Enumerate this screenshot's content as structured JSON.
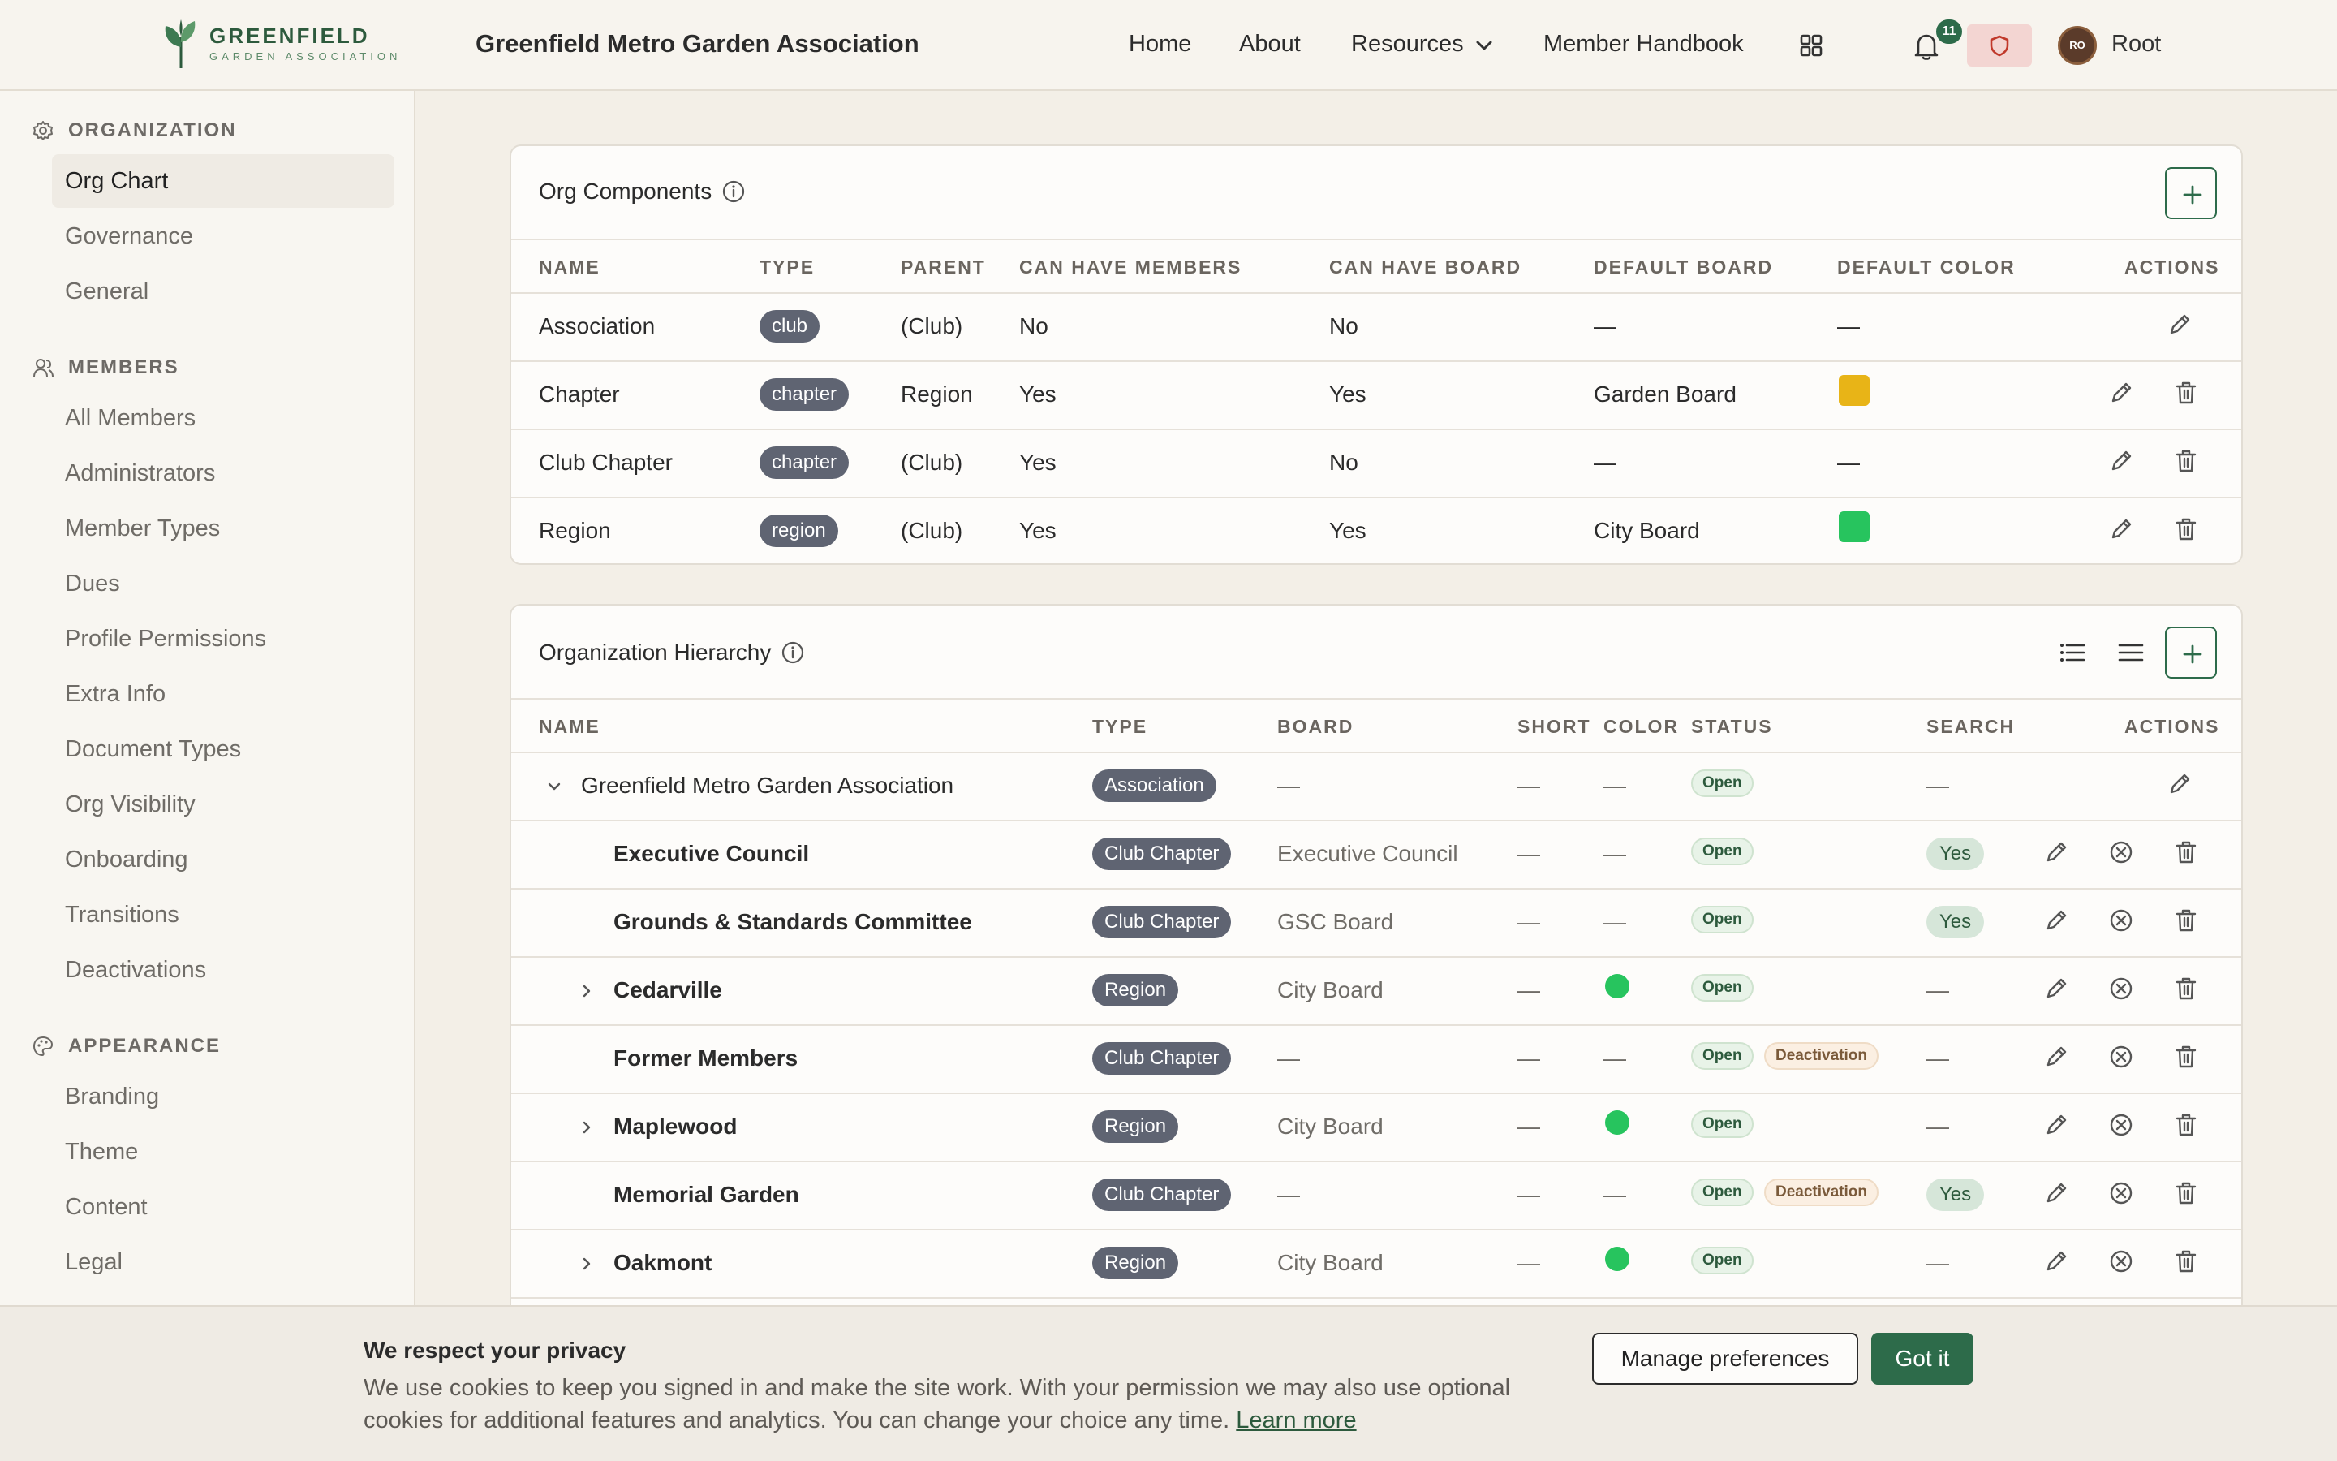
{
  "header": {
    "logo_name": "GREENFIELD",
    "logo_sub": "GARDEN ASSOCIATION",
    "site_title": "Greenfield Metro Garden Association",
    "nav": [
      "Home",
      "About",
      "Resources",
      "Member Handbook"
    ],
    "notification_count": "11",
    "avatar_initials": "RO",
    "user_name": "Root"
  },
  "sidebar": {
    "sections": [
      {
        "title": "ORGANIZATION",
        "icon": "gear-icon",
        "items": [
          "Org Chart",
          "Governance",
          "General"
        ]
      },
      {
        "title": "MEMBERS",
        "icon": "users-icon",
        "items": [
          "All Members",
          "Administrators",
          "Member Types",
          "Dues",
          "Profile Permissions",
          "Extra Info",
          "Document Types",
          "Org Visibility",
          "Onboarding",
          "Transitions",
          "Deactivations"
        ]
      },
      {
        "title": "APPEARANCE",
        "icon": "palette-icon",
        "items": [
          "Branding",
          "Theme",
          "Content",
          "Legal"
        ]
      }
    ],
    "active_item": "Org Chart"
  },
  "org_components": {
    "title": "Org Components",
    "columns": [
      "NAME",
      "TYPE",
      "PARENT",
      "CAN HAVE MEMBERS",
      "CAN HAVE BOARD",
      "DEFAULT BOARD",
      "DEFAULT COLOR",
      "ACTIONS"
    ],
    "rows": [
      {
        "name": "Association",
        "type": "club",
        "parent": "(Club)",
        "members": "No",
        "board": "No",
        "default_board": "—",
        "color": null,
        "deletable": false
      },
      {
        "name": "Chapter",
        "type": "chapter",
        "parent": "Region",
        "members": "Yes",
        "board": "Yes",
        "default_board": "Garden Board",
        "color": "#e8b417",
        "deletable": true
      },
      {
        "name": "Club Chapter",
        "type": "chapter",
        "parent": "(Club)",
        "members": "Yes",
        "board": "No",
        "default_board": "—",
        "color": null,
        "deletable": true
      },
      {
        "name": "Region",
        "type": "region",
        "parent": "(Club)",
        "members": "Yes",
        "board": "Yes",
        "default_board": "City Board",
        "color": "#27c45e",
        "deletable": true
      }
    ]
  },
  "hierarchy": {
    "title": "Organization Hierarchy",
    "columns": [
      "NAME",
      "TYPE",
      "BOARD",
      "SHORT",
      "COLOR",
      "STATUS",
      "SEARCH",
      "ACTIONS"
    ],
    "rows": [
      {
        "name": "Greenfield Metro Garden Association",
        "level": 0,
        "expander": "expanded",
        "type": "Association",
        "board": "—",
        "short": "—",
        "color": null,
        "status": [
          "Open"
        ],
        "search": "—",
        "root": true
      },
      {
        "name": "Executive Council",
        "level": 1,
        "expander": "none",
        "type": "Club Chapter",
        "board": "Executive Council",
        "short": "—",
        "color": null,
        "status": [
          "Open"
        ],
        "search": "Yes"
      },
      {
        "name": "Grounds & Standards Committee",
        "level": 1,
        "expander": "none",
        "type": "Club Chapter",
        "board": "GSC Board",
        "short": "—",
        "color": null,
        "status": [
          "Open"
        ],
        "search": "Yes"
      },
      {
        "name": "Cedarville",
        "level": 1,
        "expander": "collapsed",
        "type": "Region",
        "board": "City Board",
        "short": "—",
        "color": "#27c45e",
        "status": [
          "Open"
        ],
        "search": "—"
      },
      {
        "name": "Former Members",
        "level": 1,
        "expander": "none",
        "type": "Club Chapter",
        "board": "—",
        "short": "—",
        "color": null,
        "status": [
          "Open",
          "Deactivation"
        ],
        "search": "—"
      },
      {
        "name": "Maplewood",
        "level": 1,
        "expander": "collapsed",
        "type": "Region",
        "board": "City Board",
        "short": "—",
        "color": "#27c45e",
        "status": [
          "Open"
        ],
        "search": "—"
      },
      {
        "name": "Memorial Garden",
        "level": 1,
        "expander": "none",
        "type": "Club Chapter",
        "board": "—",
        "short": "—",
        "color": null,
        "status": [
          "Open",
          "Deactivation"
        ],
        "search": "Yes"
      },
      {
        "name": "Oakmont",
        "level": 1,
        "expander": "collapsed",
        "type": "Region",
        "board": "City Board",
        "short": "—",
        "color": "#27c45e",
        "status": [
          "Open"
        ],
        "search": "—"
      }
    ]
  },
  "cookie": {
    "title": "We respect your privacy",
    "text": "We use cookies to keep you signed in and make the site work. With your permission we may also use optional cookies for additional features and analytics. You can change your choice any time.",
    "link": "Learn more",
    "manage": "Manage preferences",
    "accept": "Got it"
  }
}
